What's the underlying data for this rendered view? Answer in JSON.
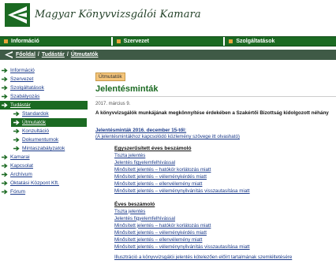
{
  "brand": {
    "name": "Magyar Könyvvizsgálói Kamara",
    "primary_color": "#1b6a22",
    "accent_color": "#e8a33a",
    "breadcrumb_bar_color": "#3f5a46"
  },
  "topnav": {
    "items": [
      {
        "label": "Információ"
      },
      {
        "label": "Szervezet"
      },
      {
        "label": "Szolgáltatások"
      }
    ]
  },
  "breadcrumb": {
    "items": [
      "Főoldal",
      "Tudástár",
      "Útmutatók"
    ],
    "separator": "/"
  },
  "sidebar": {
    "items": [
      {
        "label": "Információ"
      },
      {
        "label": "Szervezet"
      },
      {
        "label": "Szolgáltatások"
      },
      {
        "label": "Szabályozás"
      },
      {
        "label": "Tudástár"
      },
      {
        "label": "Standardok"
      },
      {
        "label": "Útmutatók"
      },
      {
        "label": "Konzultáció"
      },
      {
        "label": "Dokumentumok"
      },
      {
        "label": "Mintaszabályzatok"
      },
      {
        "label": "Kamarai"
      },
      {
        "label": "Kapcsolat"
      },
      {
        "label": "Archívum"
      },
      {
        "label": "Oktatási Központ Kft."
      },
      {
        "label": "Fórum"
      }
    ]
  },
  "main": {
    "tag": "Útmutatók",
    "title": "Jelentésminták",
    "date": "2017. március 9.",
    "intro": "A könyvvizsgálók munkájának megkönnyítése érdekében a Szakértői Bizottság kidolgozott néhány",
    "section_title": "Jelentésminták 2016. december 15-től:",
    "section_link": "(A jelentésmintákhoz kapcsolódó közlemény szövege itt olvasható)",
    "groups": [
      {
        "title": "Egyszerűsített éves beszámoló",
        "links": [
          "Tiszta jelentés",
          "Jelentés figyelemfelhívással",
          "Minősített jelentés – hatókör korlátozás miatt",
          "Minősített jelentés – véleménykérdés miatt",
          "Minősített jelentés – ellenvélemény miatt",
          "Minősített jelentés – véleménynyilvánítás visszautasítása miatt"
        ]
      },
      {
        "title": "Éves beszámoló",
        "links": [
          "Tiszta jelentés",
          "Jelentés figyelemfelhívással",
          "Minősített jelentés – hatókör korlátozás miatt",
          "Minősített jelentés – véleménykérdés miatt",
          "Minősített jelentés – ellenvélemény miatt",
          "Minősített jelentés – véleménynyilvánítás visszautasítása miatt"
        ]
      }
    ],
    "footer_link": "Illusztráció a könyvvizsgálói jelentés kötelezően előírt tartalmának szemléltetésére"
  }
}
